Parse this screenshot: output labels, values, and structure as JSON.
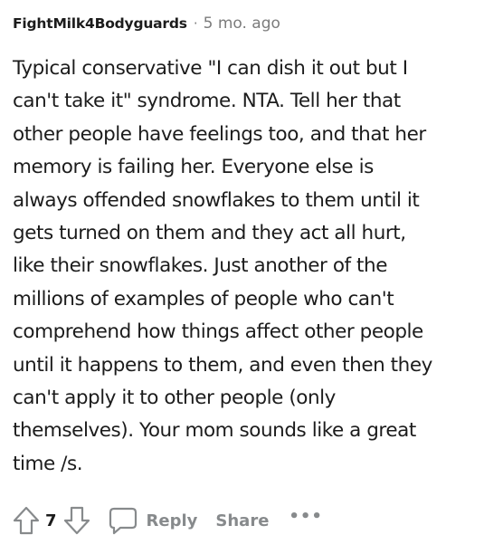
{
  "comment": {
    "username": "FightMilk4Bodyguards",
    "separator": "·",
    "age": "5 mo. ago",
    "body_lines": [
      "Typical conservative \"I can dish it out but I",
      "can't take it\" syndrome. NTA. Tell her that",
      "other people have feelings too, and that her",
      "memory is failing her. Everyone else is",
      "always offended snowflakes to them until it",
      "gets turned on them and they act all hurt,",
      "like their snowflakes. Just another of the",
      "millions of examples of people who can't",
      "comprehend how things affect other people",
      "until it happens to them, and even then they",
      "can't apply it to other people (only",
      "themselves). Your mom sounds like a great",
      "time /s."
    ]
  },
  "actions": {
    "upvote_icon": "arrow-up-icon",
    "vote_count": "7",
    "downvote_icon": "arrow-down-icon",
    "reply_icon": "comment-bubble-icon",
    "reply_label": "Reply",
    "share_label": "Share",
    "more_label": "•••"
  },
  "colors": {
    "text": "#1c1c1c",
    "muted": "#7c7c7c",
    "action": "#878a8c"
  }
}
